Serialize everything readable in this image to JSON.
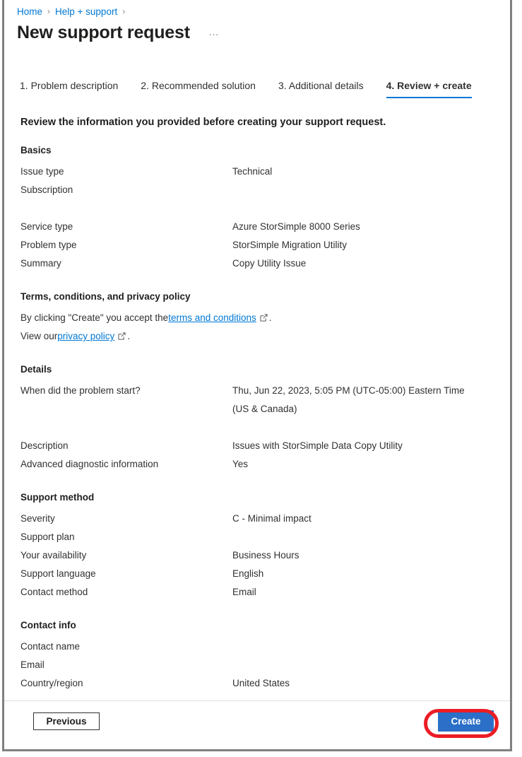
{
  "breadcrumb": {
    "items": [
      {
        "label": "Home",
        "type": "link"
      },
      {
        "label": "Help + support",
        "type": "link"
      }
    ],
    "separator": "›"
  },
  "header": {
    "title": "New support request",
    "more_menu": "…"
  },
  "tabs": [
    {
      "label": "1. Problem description",
      "active": false
    },
    {
      "label": "2. Recommended solution",
      "active": false
    },
    {
      "label": "3. Additional details",
      "active": false
    },
    {
      "label": "4. Review + create",
      "active": true
    }
  ],
  "intro": "Review the information you provided before creating your support request.",
  "sections": {
    "basics": {
      "title": "Basics",
      "rows": [
        {
          "label": "Issue type",
          "value": "Technical"
        },
        {
          "label": "Subscription",
          "value": ""
        },
        {
          "label": "",
          "value": ""
        },
        {
          "label": "Service type",
          "value": "Azure StorSimple 8000 Series"
        },
        {
          "label": "Problem type",
          "value": "StorSimple Migration Utility"
        },
        {
          "label": "Summary",
          "value": "Copy Utility Issue"
        }
      ]
    },
    "terms": {
      "title": "Terms, conditions, and privacy policy",
      "line1_prefix": "By clicking \"Create\" you accept the ",
      "line1_link": "terms and conditions",
      "line1_suffix": ".",
      "line2_prefix": "View our ",
      "line2_link": "privacy policy",
      "line2_suffix": "."
    },
    "details": {
      "title": "Details",
      "rows": [
        {
          "label": "When did the problem start?",
          "value": "Thu, Jun 22, 2023, 5:05 PM (UTC-05:00) Eastern Time (US & Canada)"
        },
        {
          "label": "Description",
          "value": "Issues with StorSimple Data Copy Utility"
        },
        {
          "label": "Advanced diagnostic information",
          "value": "Yes"
        }
      ]
    },
    "support_method": {
      "title": "Support method",
      "rows": [
        {
          "label": "Severity",
          "value": "C - Minimal impact"
        },
        {
          "label": "Support plan",
          "value": ""
        },
        {
          "label": "Your availability",
          "value": "Business Hours"
        },
        {
          "label": "Support language",
          "value": "English"
        },
        {
          "label": "Contact method",
          "value": "Email"
        }
      ]
    },
    "contact_info": {
      "title": "Contact info",
      "rows": [
        {
          "label": "Contact name",
          "value": ""
        },
        {
          "label": "Email",
          "value": ""
        },
        {
          "label": "Country/region",
          "value": "United States"
        }
      ]
    }
  },
  "footer": {
    "previous_label": "Previous",
    "create_label": "Create"
  },
  "colors": {
    "link": "#0078d4",
    "accent": "#0078d4",
    "primary_button": "#2b6fc8",
    "highlight_ring": "#ec1c24",
    "text": "#323130",
    "heading": "#201f1e",
    "border": "#808080"
  }
}
